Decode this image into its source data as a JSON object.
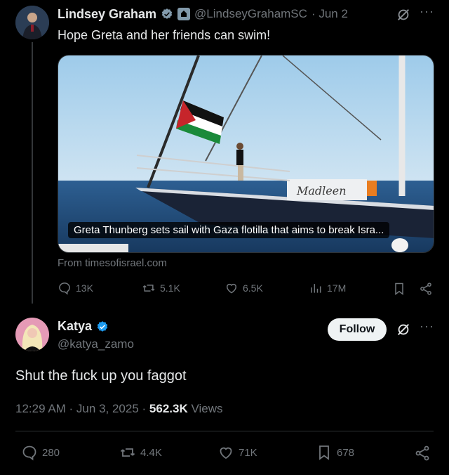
{
  "tweet1": {
    "name": "Lindsey Graham",
    "handle": "@LindseyGrahamSC",
    "date": "· Jun 2",
    "text": "Hope Greta and her friends can swim!",
    "card": {
      "boat_name": "Madleen",
      "headline": "Greta Thunberg sets sail with Gaza flotilla that aims to break Isra...",
      "source": "From timesofisrael.com"
    },
    "actions": {
      "replies": "13K",
      "reposts": "5.1K",
      "likes": "6.5K",
      "views": "17M"
    }
  },
  "reply": {
    "name": "Katya",
    "handle": "@katya_zamo",
    "follow_label": "Follow",
    "text": "Shut the fuck up you faggot",
    "time": "12:29 AM · Jun 3, 2025 · ",
    "views_count": "562.3K",
    "views_label": " Views",
    "actions": {
      "replies": "280",
      "reposts": "4.4K",
      "likes": "71K",
      "bookmarks": "678"
    }
  },
  "colors": {
    "background": "#000000",
    "text": "#e7e9ea",
    "muted": "#71767b",
    "verified": "#1d9bf0"
  }
}
